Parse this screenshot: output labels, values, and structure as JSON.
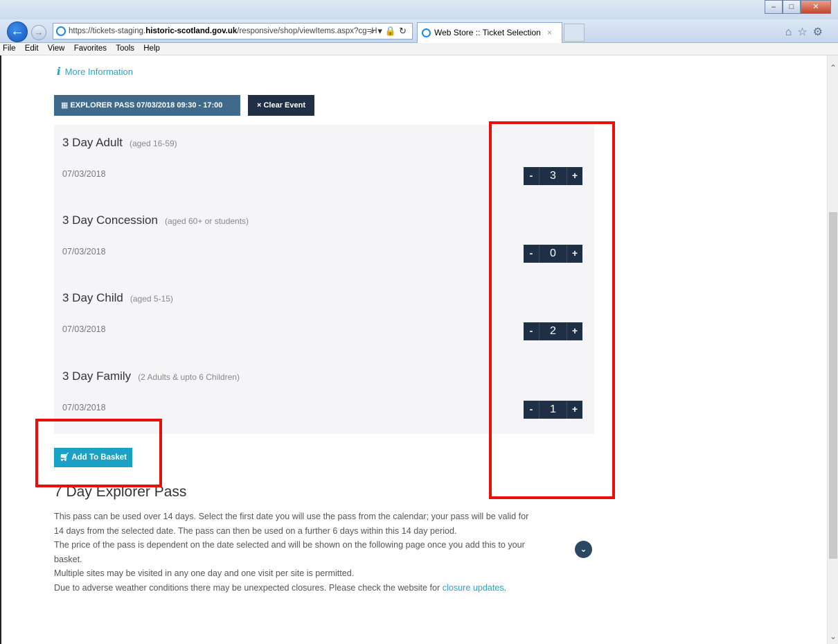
{
  "browser": {
    "url_prefix": "https://tickets-staging.",
    "url_domain": "historic-scotland.gov.uk",
    "url_suffix": "/responsive/shop/viewItems.aspx?cg=H",
    "tab_title": "Web Store :: Ticket Selection",
    "tab_close": "×",
    "menu": [
      "File",
      "Edit",
      "View",
      "Favorites",
      "Tools",
      "Help"
    ]
  },
  "page": {
    "more_info": "More Information",
    "event_button": "EXPLORER PASS 07/03/2018 09:30 - 17:00",
    "clear_button": "× Clear Event",
    "tickets": [
      {
        "name": "3 Day Adult",
        "age": "(aged 16-59)",
        "date": "07/03/2018",
        "qty": "3"
      },
      {
        "name": "3 Day Concession",
        "age": "(aged 60+ or students)",
        "date": "07/03/2018",
        "qty": "0"
      },
      {
        "name": "3 Day Child",
        "age": "(aged 5-15)",
        "date": "07/03/2018",
        "qty": "2"
      },
      {
        "name": "3 Day Family",
        "age": "(2 Adults & upto 6 Children)",
        "date": "07/03/2018",
        "qty": "1"
      }
    ],
    "minus": "-",
    "plus": "+",
    "add_basket": "Add To Basket",
    "section_title": "7 Day Explorer Pass",
    "desc": {
      "p1": "This pass can be used over 14 days. Select the first date you will use the pass from the calendar; your pass will be valid for 14 days from the selected date. The pass can then be used on a further 6 days within this 14 day period.",
      "p2": "The price of the pass is dependent on the date selected and will be shown on the following page once you add this to your basket.",
      "p3": "Multiple sites may be visited in any one day and one visit per site is permitted.",
      "p4_prefix": "Due to adverse weather conditions there may be unexpected closures. Please check the website for ",
      "p4_link": "closure updates",
      "p4_suffix": "."
    }
  },
  "colors": {
    "accent": "#1ba1c6",
    "dark_button": "#1f2f45",
    "event_button": "#3f6a8c",
    "highlight": "#e8100c"
  }
}
